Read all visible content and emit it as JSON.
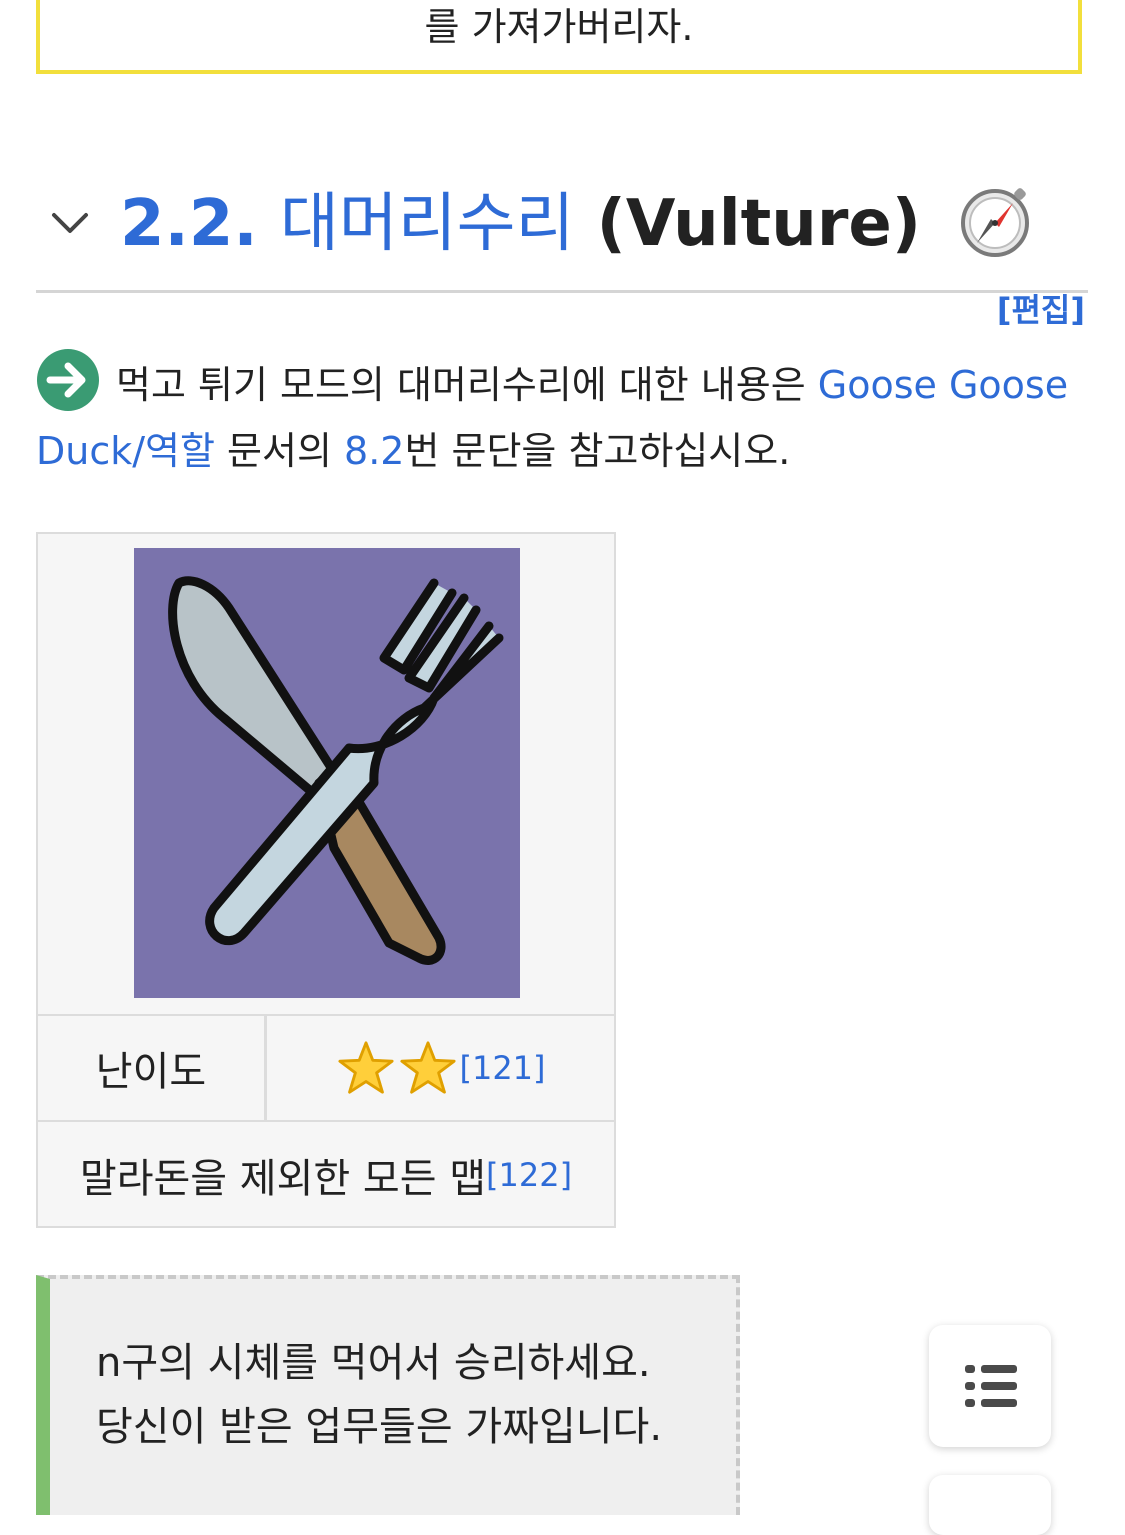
{
  "top_box": {
    "text": "를 가져가버리자."
  },
  "section": {
    "number": "2.2.",
    "title_ko": "대머리수리",
    "title_en": "(Vulture)",
    "edit_label": "[편집]"
  },
  "redirect": {
    "prefix": "먹고 튀기 모드의 대머리수리에 대한 내용은 ",
    "link": "Goose Goose Duck/역할",
    "middle": " 문서의 ",
    "section_link": "8.2",
    "suffix": "번 문단을 참고하십시오."
  },
  "infobox": {
    "difficulty_label": "난이도",
    "difficulty_stars": 2,
    "difficulty_ref": "[121]",
    "maps_text": "말라돈을 제외한 모든 맵",
    "maps_ref": "[122]"
  },
  "quote": {
    "line1": "n구의 시체를 먹어서 승리하세요.",
    "line2": "당신이 받은 업무들은 가짜입니다."
  },
  "colors": {
    "link": "#2e6bd6",
    "top_box_border": "#f2df3c",
    "quote_border": "#7fbf6e",
    "infobox_image_bg": "#7a73ac",
    "arrow_icon_bg": "#3a9b73"
  },
  "icons": {
    "collapse": "chevron-down-icon",
    "compass": "compass-icon",
    "redirect": "arrow-right-icon",
    "toc": "list-icon",
    "star": "star-icon"
  }
}
